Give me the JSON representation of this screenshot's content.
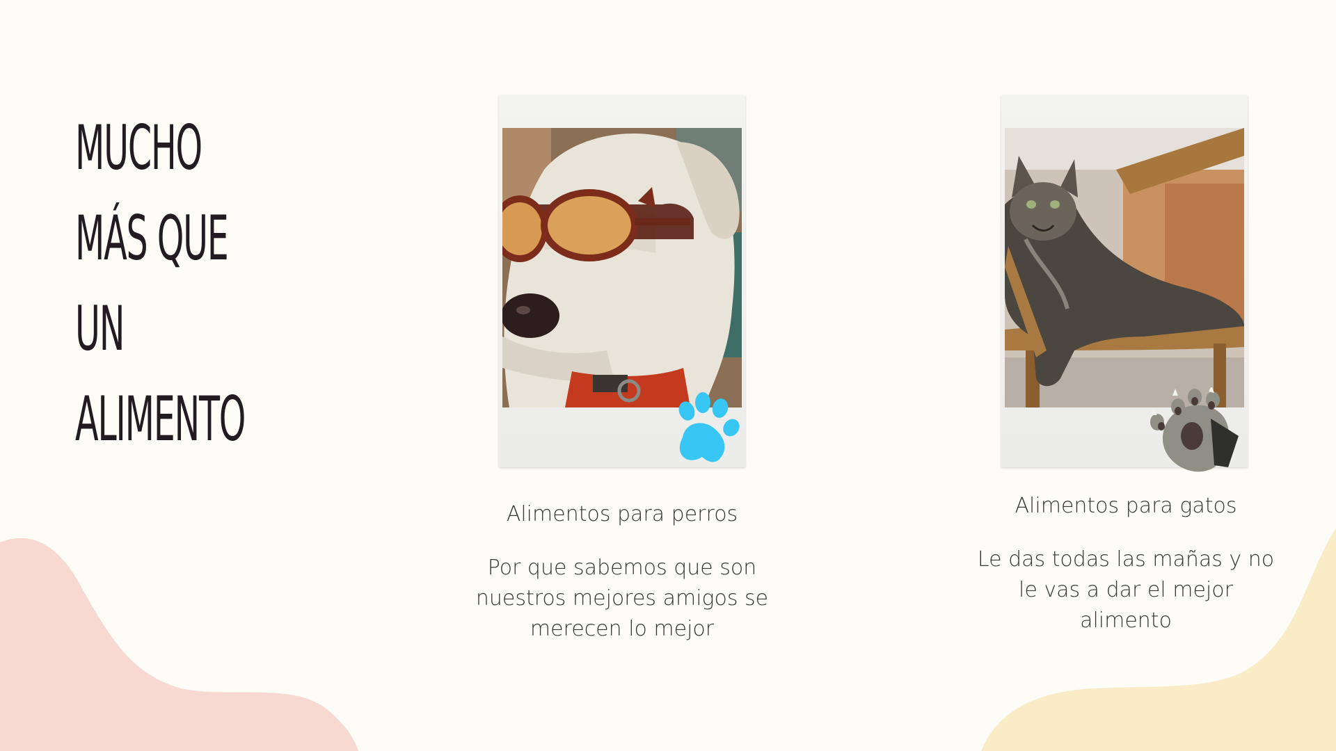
{
  "headline": {
    "text": "Mucho más que un alimento"
  },
  "cards": [
    {
      "title": "Alimentos para perros",
      "description": "Por que sabemos que son nuestros mejores amigos se merecen lo mejor",
      "photo": "dog-with-sunglasses",
      "sticker": "blue-paw-icon"
    },
    {
      "title": "Alimentos para gatos",
      "description": "Le das todas las mañas y no le vas a dar el mejor alimento",
      "photo": "tabby-cat-on-chair",
      "sticker": "cat-paw-icon"
    }
  ],
  "colors": {
    "background": "#fdfcf6",
    "blob_left": "#f8d9d1",
    "blob_right": "#fbecc8",
    "headline": "#221b21",
    "body_text": "#3a3638",
    "paw_blue": "#38c6f4",
    "cat_paw_gray": "#8f8f86"
  }
}
